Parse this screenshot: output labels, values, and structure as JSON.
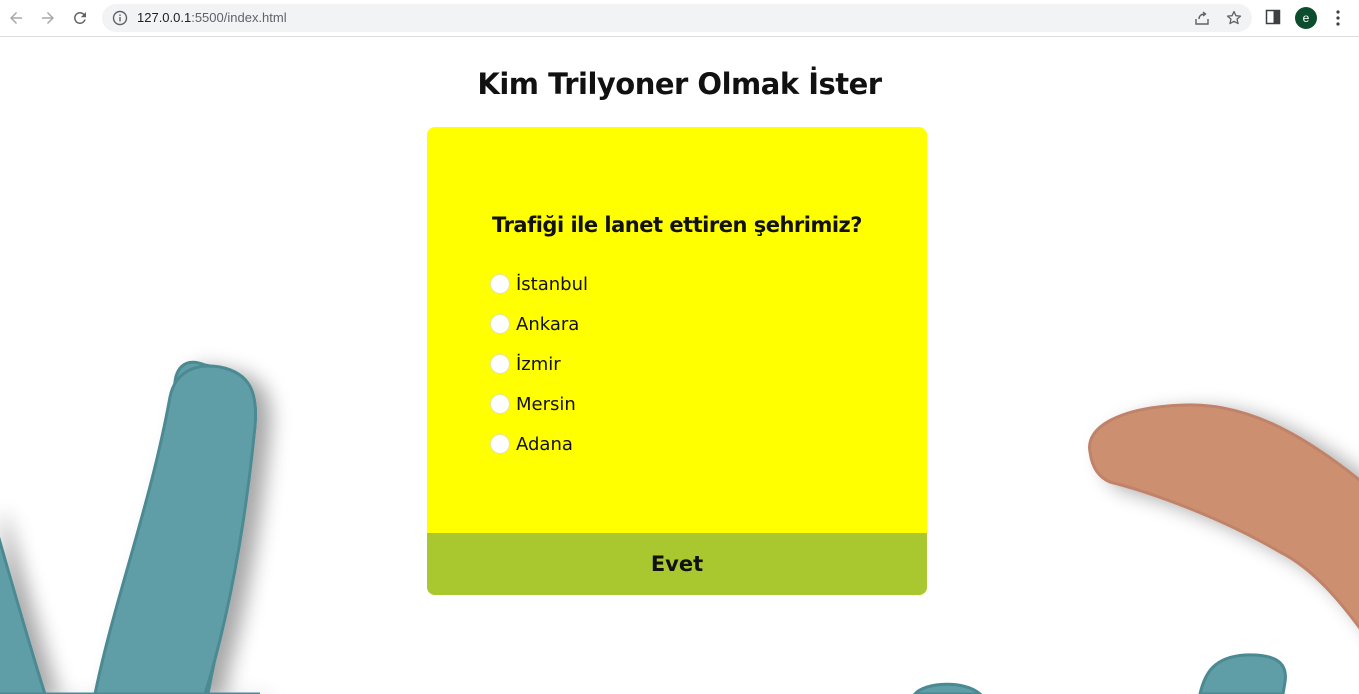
{
  "browser": {
    "url_host": "127.0.0.1",
    "url_rest": ":5500/index.html",
    "profile_initial": "e",
    "icons": [
      "back-arrow-icon",
      "forward-arrow-icon",
      "reload-icon",
      "info-icon",
      "share-icon",
      "star-icon",
      "side-panel-icon",
      "kebab-menu-icon"
    ]
  },
  "page": {
    "title": "Kim Trilyoner Olmak İster",
    "quiz": {
      "question": "Trafiği ile lanet ettiren şehrimiz?",
      "answers": [
        "İstanbul",
        "Ankara",
        "İzmir",
        "Mersin",
        "Adana"
      ],
      "submit_label": "Evet"
    }
  },
  "colors": {
    "card_background": "#ffff00",
    "submit_background": "#a9c72e",
    "decor_teal": "#5f9ea6",
    "decor_tan": "#cc9070"
  }
}
